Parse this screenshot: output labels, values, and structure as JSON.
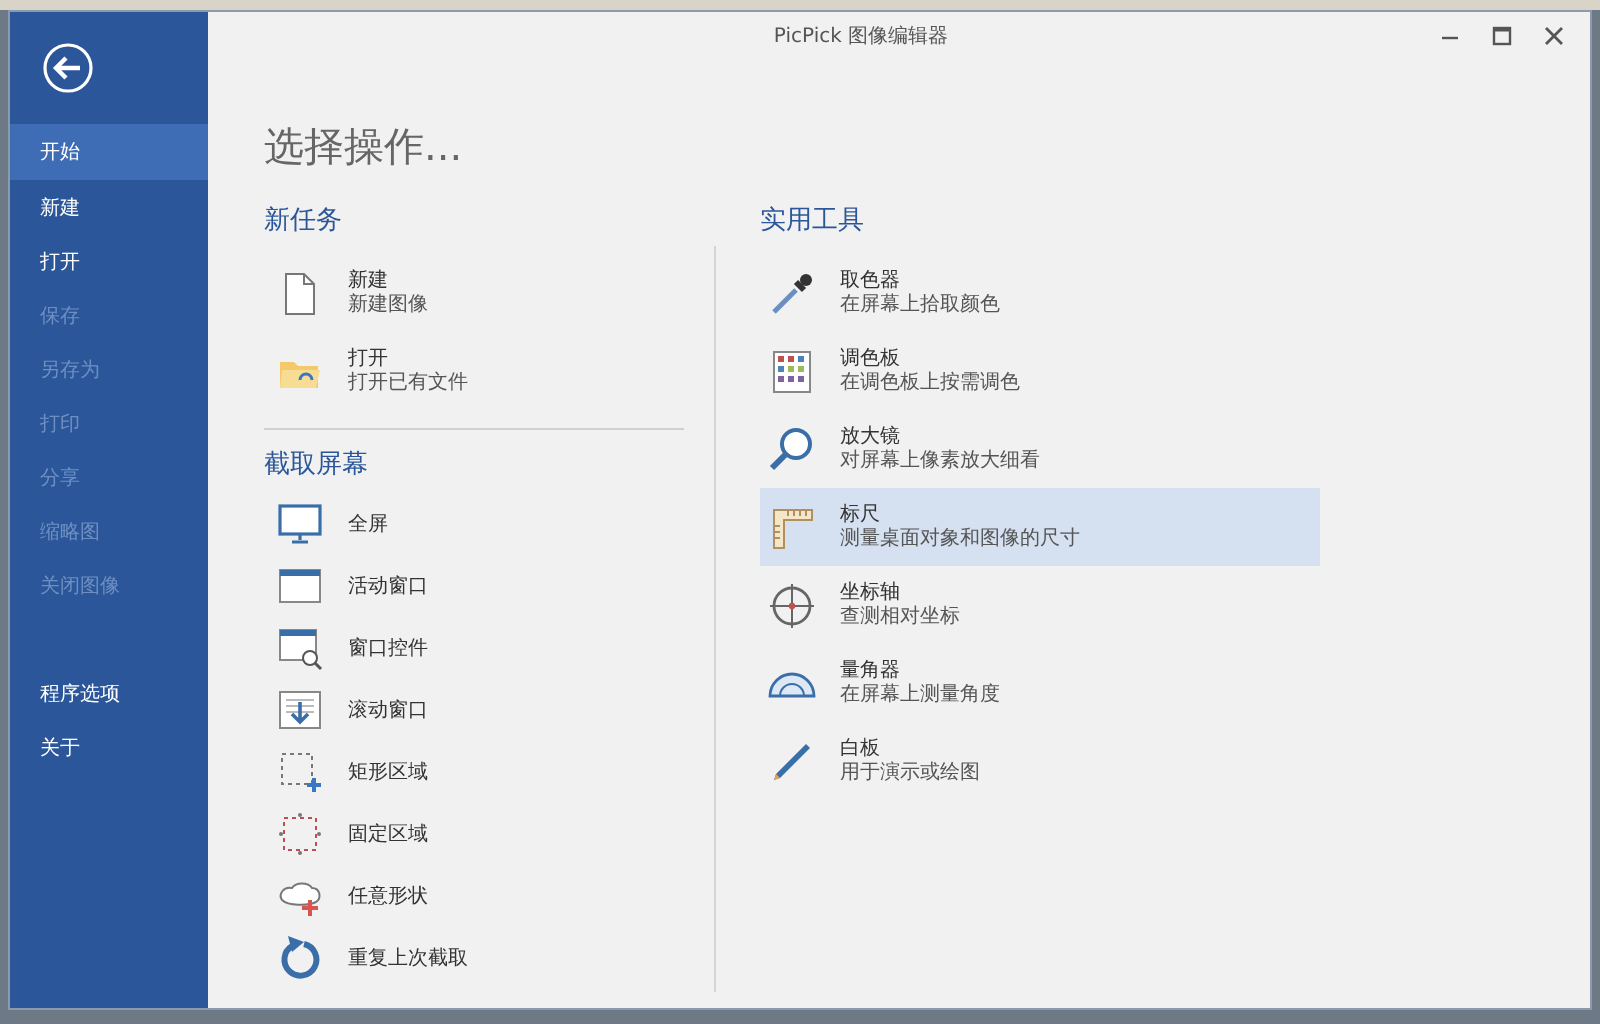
{
  "window": {
    "title": "PicPick 图像编辑器"
  },
  "sidebar": {
    "items": [
      {
        "label": "开始",
        "selected": true,
        "disabled": false
      },
      {
        "label": "新建",
        "selected": false,
        "disabled": false
      },
      {
        "label": "打开",
        "selected": false,
        "disabled": false
      },
      {
        "label": "保存",
        "selected": false,
        "disabled": true
      },
      {
        "label": "另存为",
        "selected": false,
        "disabled": true
      },
      {
        "label": "打印",
        "selected": false,
        "disabled": true
      },
      {
        "label": "分享",
        "selected": false,
        "disabled": true
      },
      {
        "label": "缩略图",
        "selected": false,
        "disabled": true
      },
      {
        "label": "关闭图像",
        "selected": false,
        "disabled": true
      }
    ],
    "bottom_items": [
      {
        "label": "程序选项",
        "selected": false,
        "disabled": false
      },
      {
        "label": "关于",
        "selected": false,
        "disabled": false
      }
    ]
  },
  "heading": "选择操作...",
  "new_task": {
    "heading": "新任务",
    "items": [
      {
        "title": "新建",
        "subtitle": "新建图像"
      },
      {
        "title": "打开",
        "subtitle": "打开已有文件"
      }
    ]
  },
  "capture": {
    "heading": "截取屏幕",
    "items": [
      {
        "label": "全屏"
      },
      {
        "label": "活动窗口"
      },
      {
        "label": "窗口控件"
      },
      {
        "label": "滚动窗口"
      },
      {
        "label": "矩形区域"
      },
      {
        "label": "固定区域"
      },
      {
        "label": "任意形状"
      },
      {
        "label": "重复上次截取"
      }
    ]
  },
  "tools": {
    "heading": "实用工具",
    "items": [
      {
        "title": "取色器",
        "subtitle": "在屏幕上拾取颜色",
        "selected": false
      },
      {
        "title": "调色板",
        "subtitle": "在调色板上按需调色",
        "selected": false
      },
      {
        "title": "放大镜",
        "subtitle": "对屏幕上像素放大细看",
        "selected": false
      },
      {
        "title": "标尺",
        "subtitle": "测量桌面对象和图像的尺寸",
        "selected": true
      },
      {
        "title": "坐标轴",
        "subtitle": "查测相对坐标",
        "selected": false
      },
      {
        "title": "量角器",
        "subtitle": "在屏幕上测量角度",
        "selected": false
      },
      {
        "title": "白板",
        "subtitle": "用于演示或绘图",
        "selected": false
      }
    ]
  }
}
